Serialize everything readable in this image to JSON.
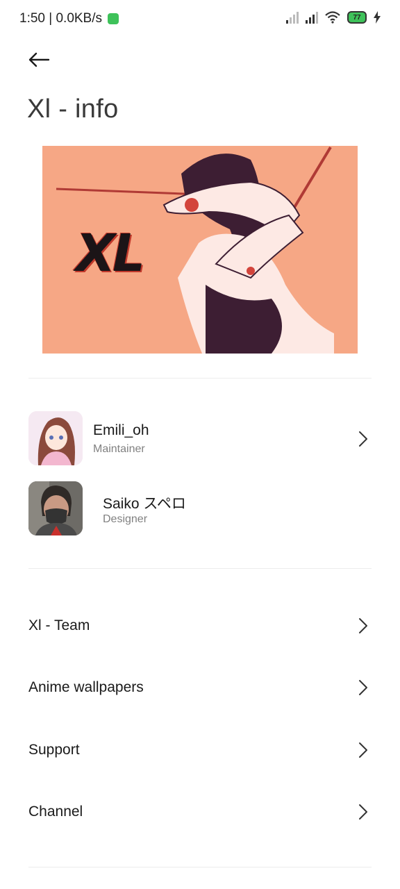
{
  "status_bar": {
    "time_speed": "1:50 | 0.0KB/s",
    "battery": "77"
  },
  "header": {
    "title": "Xl - info"
  },
  "banner": {
    "logo_text": "XL"
  },
  "contributors": [
    {
      "name": "Emili_oh",
      "role": "Maintainer"
    },
    {
      "name": "Saiko スペロ",
      "role": "Designer"
    }
  ],
  "menu": [
    {
      "label": "Xl - Team"
    },
    {
      "label": "Anime wallpapers"
    },
    {
      "label": "Support"
    },
    {
      "label": "Channel"
    }
  ],
  "colors": {
    "banner_bg": "#f6a785",
    "text_primary": "#1a1a1a",
    "text_secondary": "#808080",
    "divider": "#ececec"
  }
}
